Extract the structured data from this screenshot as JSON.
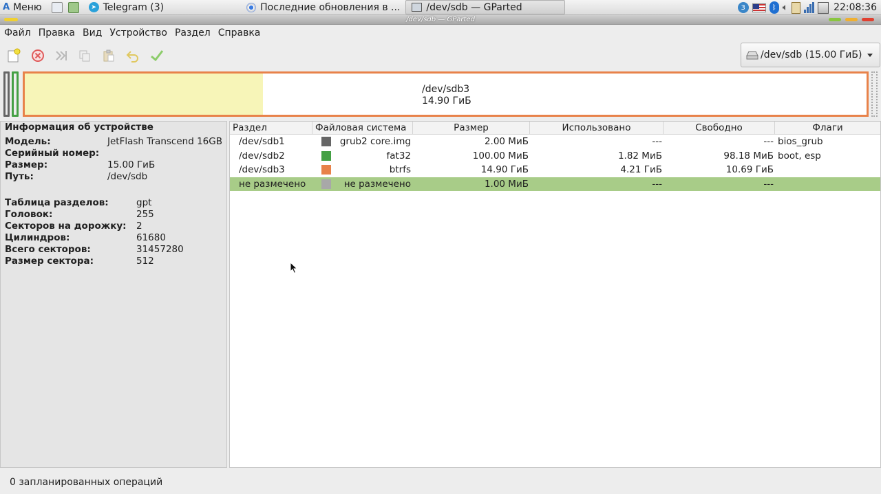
{
  "taskbar": {
    "menu_label": "Меню",
    "tasks": [
      {
        "label": "Telegram (3)"
      },
      {
        "label": "Последние обновления в ..."
      },
      {
        "label": "/dev/sdb — GParted"
      }
    ],
    "clock": "22:08:36",
    "tray_badge": "3"
  },
  "window": {
    "title": "/dev/sdb — GParted"
  },
  "menubar": [
    "Файл",
    "Правка",
    "Вид",
    "Устройство",
    "Раздел",
    "Справка"
  ],
  "toolbar": {
    "icons": [
      "new-icon",
      "delete-icon",
      "resize-icon",
      "copy-icon",
      "paste-icon",
      "undo-icon",
      "apply-icon"
    ],
    "device_selector": "/dev/sdb (15.00 ГиБ)"
  },
  "disk_map": {
    "main_partition": "/dev/sdb3",
    "main_size": "14.90 ГиБ",
    "used_fraction": 0.283,
    "colors": {
      "sdb1": "#666666",
      "sdb2": "#44a044",
      "sdb3": "#e8824a",
      "unallocated": "#a8a8a8",
      "used": "#f7f5b8"
    }
  },
  "device_info": {
    "title": "Информация об устройстве",
    "group1": [
      {
        "key": "Модель:",
        "value": "JetFlash Transcend 16GB"
      },
      {
        "key": "Серийный номер:",
        "value": ""
      },
      {
        "key": "Размер:",
        "value": "15.00 ГиБ"
      },
      {
        "key": "Путь:",
        "value": "/dev/sdb"
      }
    ],
    "group2": [
      {
        "key": "Таблица разделов:",
        "value": "gpt"
      },
      {
        "key": "Головок:",
        "value": "255"
      },
      {
        "key": "Секторов на дорожку:",
        "value": "2"
      },
      {
        "key": "Цилиндров:",
        "value": "61680"
      },
      {
        "key": "Всего секторов:",
        "value": "31457280"
      },
      {
        "key": "Размер сектора:",
        "value": "512"
      }
    ]
  },
  "table": {
    "headers": [
      "Раздел",
      "Файловая система",
      "Размер",
      "Использовано",
      "Свободно",
      "Флаги"
    ],
    "rows": [
      {
        "partition": "/dev/sdb1",
        "fs": "grub2 core.img",
        "color": "#666666",
        "size": "2.00 МиБ",
        "used": "---",
        "free": "---",
        "flags": "bios_grub"
      },
      {
        "partition": "/dev/sdb2",
        "fs": "fat32",
        "color": "#44a044",
        "size": "100.00 МиБ",
        "used": "1.82 МиБ",
        "free": "98.18 МиБ",
        "flags": "boot, esp"
      },
      {
        "partition": "/dev/sdb3",
        "fs": "btrfs",
        "color": "#e8824a",
        "size": "14.90 ГиБ",
        "used": "4.21 ГиБ",
        "free": "10.69 ГиБ",
        "flags": ""
      },
      {
        "partition": "не размечено",
        "fs": "не размечено",
        "color": "#a8a8a8",
        "size": "1.00 МиБ",
        "used": "---",
        "free": "---",
        "flags": ""
      }
    ],
    "selected_row": 3
  },
  "statusbar": {
    "text": "0 запланированных операций"
  }
}
